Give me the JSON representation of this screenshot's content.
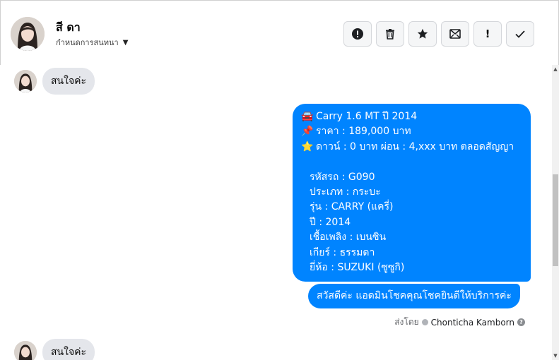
{
  "header": {
    "contact_name": "สี ดา",
    "subtitle": "กำหนดการสนทนา",
    "actions": [
      {
        "name": "report-icon",
        "label": "Report"
      },
      {
        "name": "trash-icon",
        "label": "Delete"
      },
      {
        "name": "star-icon",
        "label": "Star"
      },
      {
        "name": "mark-unread-icon",
        "label": "Mark unread"
      },
      {
        "name": "exclamation-icon",
        "label": "!"
      },
      {
        "name": "check-icon",
        "label": "Done"
      }
    ]
  },
  "messages": {
    "incoming_1": "สนใจค่ะ",
    "incoming_2": "สนใจค่ะ",
    "card": {
      "title": "Carry 1.6 MT ปี 2014",
      "price": "ราคา : 189,000 บาท",
      "down": "ดาวน์ : 0 บาท ผ่อน : 4,xxx บาท ตลอดสัญญา",
      "details": [
        "รหัสรถ : G090",
        "ประเภท : กระบะ",
        "รุ่น : CARRY (แครี่)",
        "ปี : 2014",
        "เชื้อเพลิง : เบนซิน",
        "เกียร์ : ธรรมดา",
        "ยี่ห้อ : SUZUKI (ซูซูกิ)"
      ],
      "icons": {
        "title": "car-icon",
        "price": "pin-icon",
        "down": "star-icon"
      }
    },
    "greeting": "สวัสดีค่ะ แอดมินโชคคุณโชคยินดีให้บริการค่ะ",
    "sent_by_label": "ส่งโดย",
    "sent_by_name": "Chonticha Kamborn"
  },
  "colors": {
    "accent": "#0084ff",
    "incoming_bubble": "#e4e6eb",
    "background": "#f0f2f5"
  }
}
